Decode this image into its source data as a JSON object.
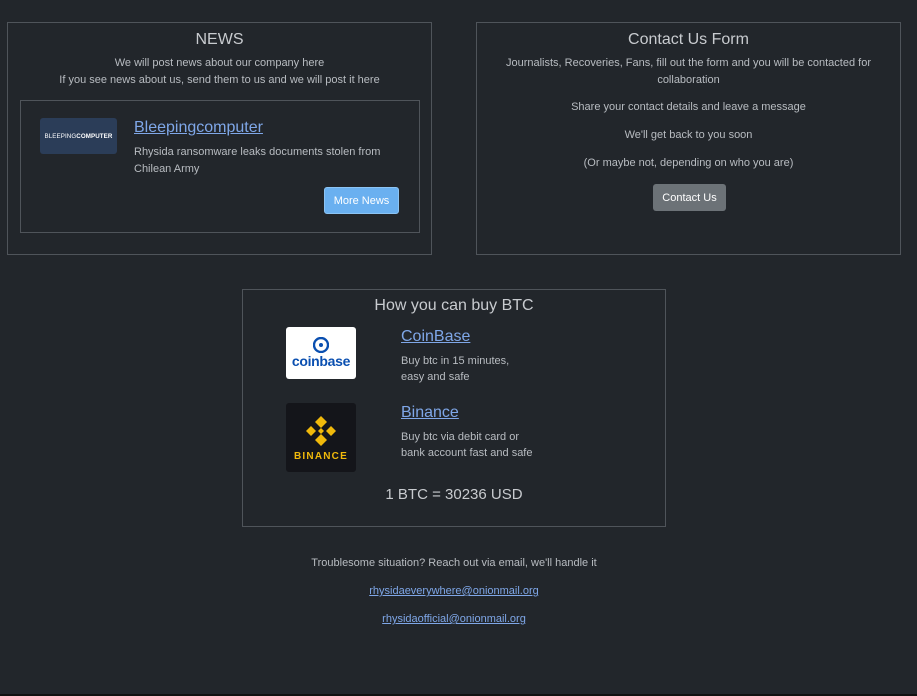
{
  "news": {
    "title": "NEWS",
    "intro_line1": "We will post news about our company here",
    "intro_line2": "If you see news about us, send them to us and we will post it here",
    "card": {
      "logo_text_a": "BLEEPING",
      "logo_text_b": "COMPUTER",
      "source": "Bleepingcomputer",
      "summary_line1": "Rhysida ransomware leaks documents stolen from",
      "summary_line2": "Chilean Army"
    },
    "more_button": "More News"
  },
  "contact": {
    "title": "Contact Us Form",
    "line1": "Journalists, Recoveries, Fans, fill out the form and you will be contacted for",
    "line2": "collaboration",
    "line3": "Share your contact details and leave a message",
    "line4": "We'll get back to you soon",
    "line5": "(Or maybe not, depending on who you are)",
    "button": "Contact Us"
  },
  "btc": {
    "title": "How you can buy BTC",
    "exchanges": [
      {
        "name": "CoinBase",
        "logo_text": "coinbase",
        "desc_line1": "Buy btc in 15 minutes,",
        "desc_line2": "easy and safe",
        "icon": "coinbase-icon"
      },
      {
        "name": "Binance",
        "logo_text": "BINANCE",
        "desc_line1": "Buy btc via debit card or",
        "desc_line2": "bank account fast and safe",
        "icon": "binance-icon"
      }
    ],
    "rate": "1 BTC = 30236 USD"
  },
  "footer": {
    "text": "Troublesome situation? Reach out via email, we'll handle it",
    "email1": "rhysidaeverywhere@onionmail.org",
    "email2": "rhysidaofficial@onionmail.org"
  },
  "colors": {
    "background": "#22262b",
    "border": "#4f545a",
    "link": "#7fa7e8",
    "primary_button": "#6ab0f0",
    "secondary_button": "#6c7277"
  }
}
